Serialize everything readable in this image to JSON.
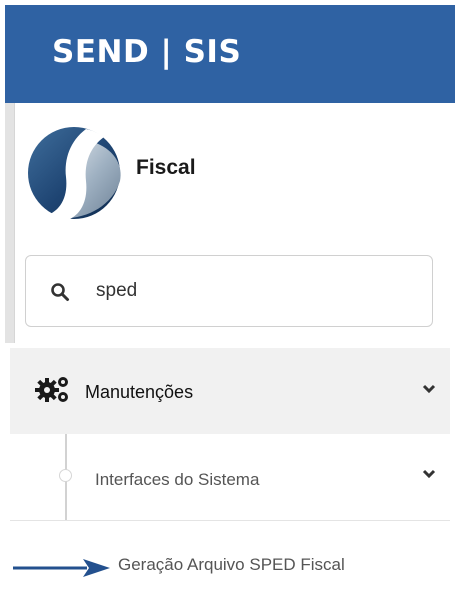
{
  "header": {
    "brand": "SEND | SIS"
  },
  "module": {
    "title": "Fiscal"
  },
  "search": {
    "value": "sped",
    "icon": "search-icon"
  },
  "menu": {
    "main": {
      "label": "Manutenções",
      "icon": "gears-icon"
    },
    "sub": {
      "label": "Interfaces do Sistema"
    },
    "leaf": {
      "label": "Geração Arquivo SPED Fiscal"
    }
  },
  "colors": {
    "header_bg": "#2f62a3",
    "menu_active_bg": "#f1f1f1",
    "arrow": "#23508e",
    "logo_dark": "#1e4472",
    "logo_light": "#8fa3b7"
  }
}
